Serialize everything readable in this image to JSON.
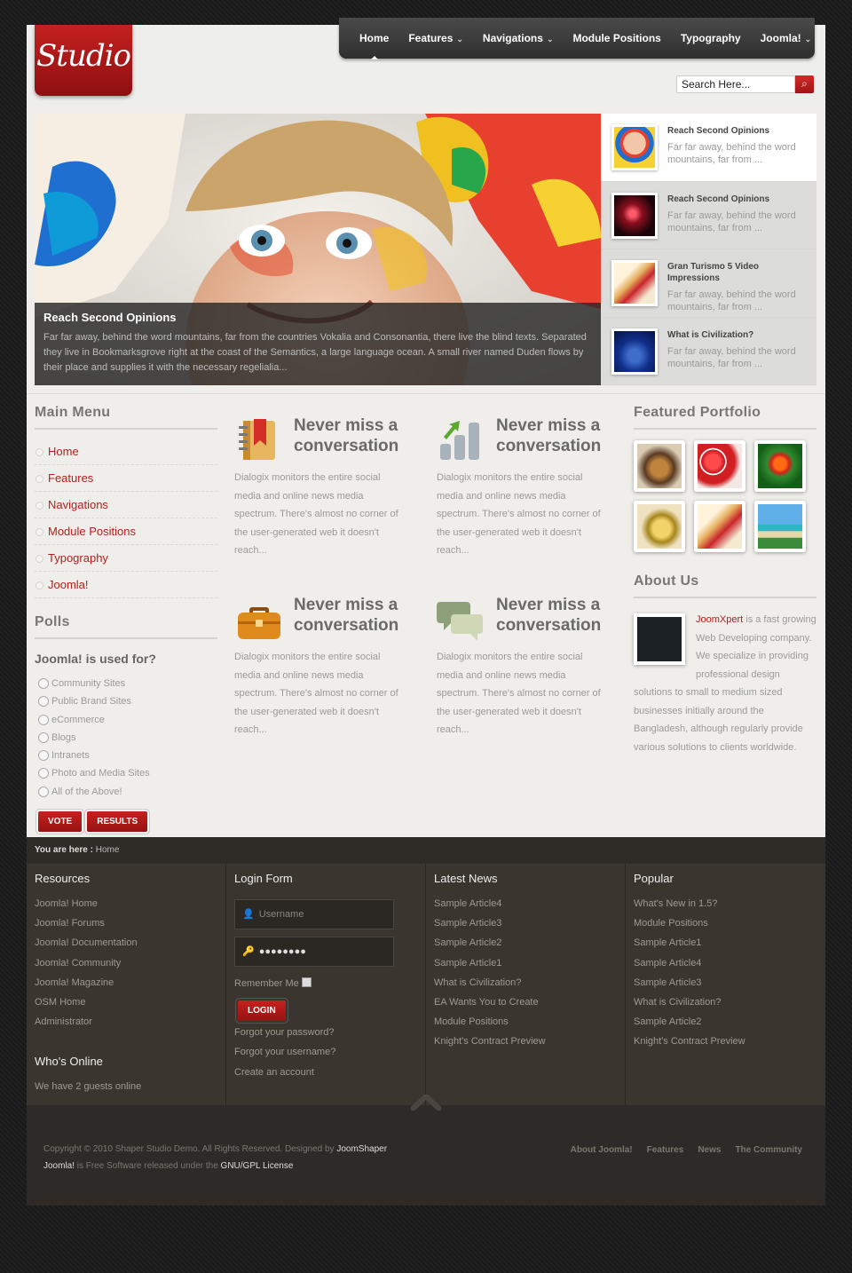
{
  "logo": "Studio",
  "nav": [
    {
      "label": "Home",
      "dropdown": false,
      "active": true
    },
    {
      "label": "Features",
      "dropdown": true
    },
    {
      "label": "Navigations",
      "dropdown": true
    },
    {
      "label": "Module Positions",
      "dropdown": false
    },
    {
      "label": "Typography",
      "dropdown": false
    },
    {
      "label": "Joomla!",
      "dropdown": true
    }
  ],
  "search": {
    "placeholder": "Search Here..."
  },
  "slider": {
    "title": "Reach Second Opinions",
    "text": "Far far away, behind the word mountains, far from the countries Vokalia and Consonantia, there live the blind texts. Separated they live in Bookmarksgrove right at the coast of the Semantics, a large language ocean. A small river named Duden flows by their place and supplies it with the necessary regelialia...",
    "items": [
      {
        "title": "Reach Second Opinions",
        "text": "Far far away, behind the word mountains, far from ..."
      },
      {
        "title": "Reach Second Opinions",
        "text": "Far far away, behind the word mountains, far from ..."
      },
      {
        "title": "Gran Turismo 5 Video Impressions",
        "text": "Far far away, behind the word mountains, far from ..."
      },
      {
        "title": "What is Civilization?",
        "text": "Far far away, behind the word mountains, far from ..."
      }
    ]
  },
  "main_menu": {
    "title": "Main Menu",
    "items": [
      "Home",
      "Features",
      "Navigations",
      "Module Positions",
      "Typography",
      "Joomla!"
    ]
  },
  "polls": {
    "title": "Polls",
    "question": "Joomla! is used for?",
    "options": [
      "Community Sites",
      "Public Brand Sites",
      "eCommerce",
      "Blogs",
      "Intranets",
      "Photo and Media Sites",
      "All of the Above!"
    ],
    "vote": "VOTE",
    "results": "RESULTS"
  },
  "features": [
    {
      "title": "Never miss a conversation",
      "text": "Dialogix monitors the entire social media and online news media spectrum. There's almost no corner of the user-generated web it doesn't reach...",
      "icon": "notebook-icon"
    },
    {
      "title": "Never miss a conversation",
      "text": "Dialogix monitors the entire social media and online news media spectrum. There's almost no corner of the user-generated web it doesn't reach...",
      "icon": "bar-chart-icon"
    },
    {
      "title": "Never miss a conversation",
      "text": "Dialogix monitors the entire social media and online news media spectrum. There's almost no corner of the user-generated web it doesn't reach...",
      "icon": "briefcase-icon"
    },
    {
      "title": "Never miss a conversation",
      "text": "Dialogix monitors the entire social media and online news media spectrum. There's almost no corner of the user-generated web it doesn't reach...",
      "icon": "chat-bubbles-icon"
    }
  ],
  "portfolio": {
    "title": "Featured Portfolio"
  },
  "about": {
    "title": "About Us",
    "brand": "JoomXpert",
    "text": " is a fast growing Web Developing company. We specialize in providing professional design solutions to small to medium sized businesses initially around the Bangladesh, although regularly provide various solutions to clients worldwide."
  },
  "breadcrumb": {
    "label": "You are here :",
    "current": "Home"
  },
  "footer": {
    "resources": {
      "title": "Resources",
      "links": [
        "Joomla! Home",
        "Joomla! Forums",
        "Joomla! Documentation",
        "Joomla! Community",
        "Joomla! Magazine",
        "OSM Home",
        "Administrator"
      ]
    },
    "whos_online": {
      "title": "Who's Online",
      "text": "We have 2 guests online"
    },
    "login": {
      "title": "Login Form",
      "username_placeholder": "Username",
      "password_value": "●●●●●●●●",
      "remember": "Remember Me",
      "button": "LOGIN",
      "links": [
        "Forgot your password?",
        "Forgot your username?",
        "Create an account"
      ]
    },
    "latest": {
      "title": "Latest News",
      "links": [
        "Sample Article4",
        "Sample Article3",
        "Sample Article2",
        "Sample Article1",
        "What is Civilization?",
        "EA Wants You to Create",
        "Module Positions",
        "Knight's Contract Preview"
      ]
    },
    "popular": {
      "title": "Popular",
      "links": [
        "What's New in 1.5?",
        "Module Positions",
        "Sample Article1",
        "Sample Article4",
        "Sample Article3",
        "What is Civilization?",
        "Sample Article2",
        "Knight's Contract Preview"
      ]
    }
  },
  "copyright": {
    "line1_prefix": "Copyright © 2010 Shaper Studio Demo. All Rights Reserved. Designed by ",
    "line1_link": "JoomShaper",
    "line2_link1": "Joomla!",
    "line2_mid": " is Free Software released under the ",
    "line2_link2": "GNU/GPL License"
  },
  "footer_menu": [
    "About Joomla!",
    "Features",
    "News",
    "The Community"
  ],
  "colors": {
    "accent": "#b3201c",
    "nav_bg": "#3a3a3a",
    "footer_bg": "#3a352f"
  }
}
